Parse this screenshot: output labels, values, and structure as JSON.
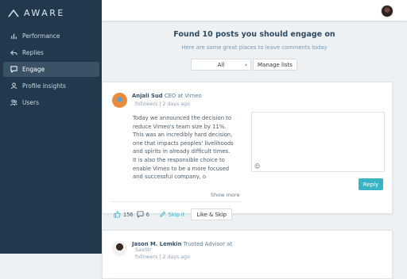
{
  "brand": {
    "name": "AWARE"
  },
  "nav": {
    "items": [
      {
        "label": "Performance",
        "icon": "bar-chart-icon"
      },
      {
        "label": "Replies",
        "icon": "reply-icon"
      },
      {
        "label": "Engage",
        "icon": "chat-bubble-icon",
        "active": true
      },
      {
        "label": "Profile insights",
        "icon": "person-icon"
      },
      {
        "label": "Users",
        "icon": "users-icon"
      }
    ]
  },
  "main": {
    "title": "Found 10 posts you should engage on",
    "subtitle": "Here are some great places to leave comments today",
    "filter_value": "All",
    "manage_lists_label": "Manage lists"
  },
  "posts": [
    {
      "author": "Anjali Sud",
      "role": "CEO at Vimeo",
      "meta": "followers | 2 days ago",
      "text": "Today we announced the decision to reduce Vimeo's team size by 11%. This was an incredibly hard decision, one that impacts peoples' livelihoods and spirits in already difficult times. It is also the responsible choice to enable Vimeo to be a more focused and successful company, o",
      "show_more": "Show more",
      "likes": "156",
      "comments": "6",
      "skip_label": "Skip it",
      "like_skip_label": "Like & Skip",
      "reply_label": "Reply",
      "emoji": "☺"
    },
    {
      "author": "Jason M. Lemkin",
      "role": "Trusted Advisor at",
      "role2": "SaaStr",
      "meta": "followers | 2 days ago"
    }
  ],
  "colors": {
    "sidebar": "#22394d",
    "accent": "#3ab3c6"
  }
}
